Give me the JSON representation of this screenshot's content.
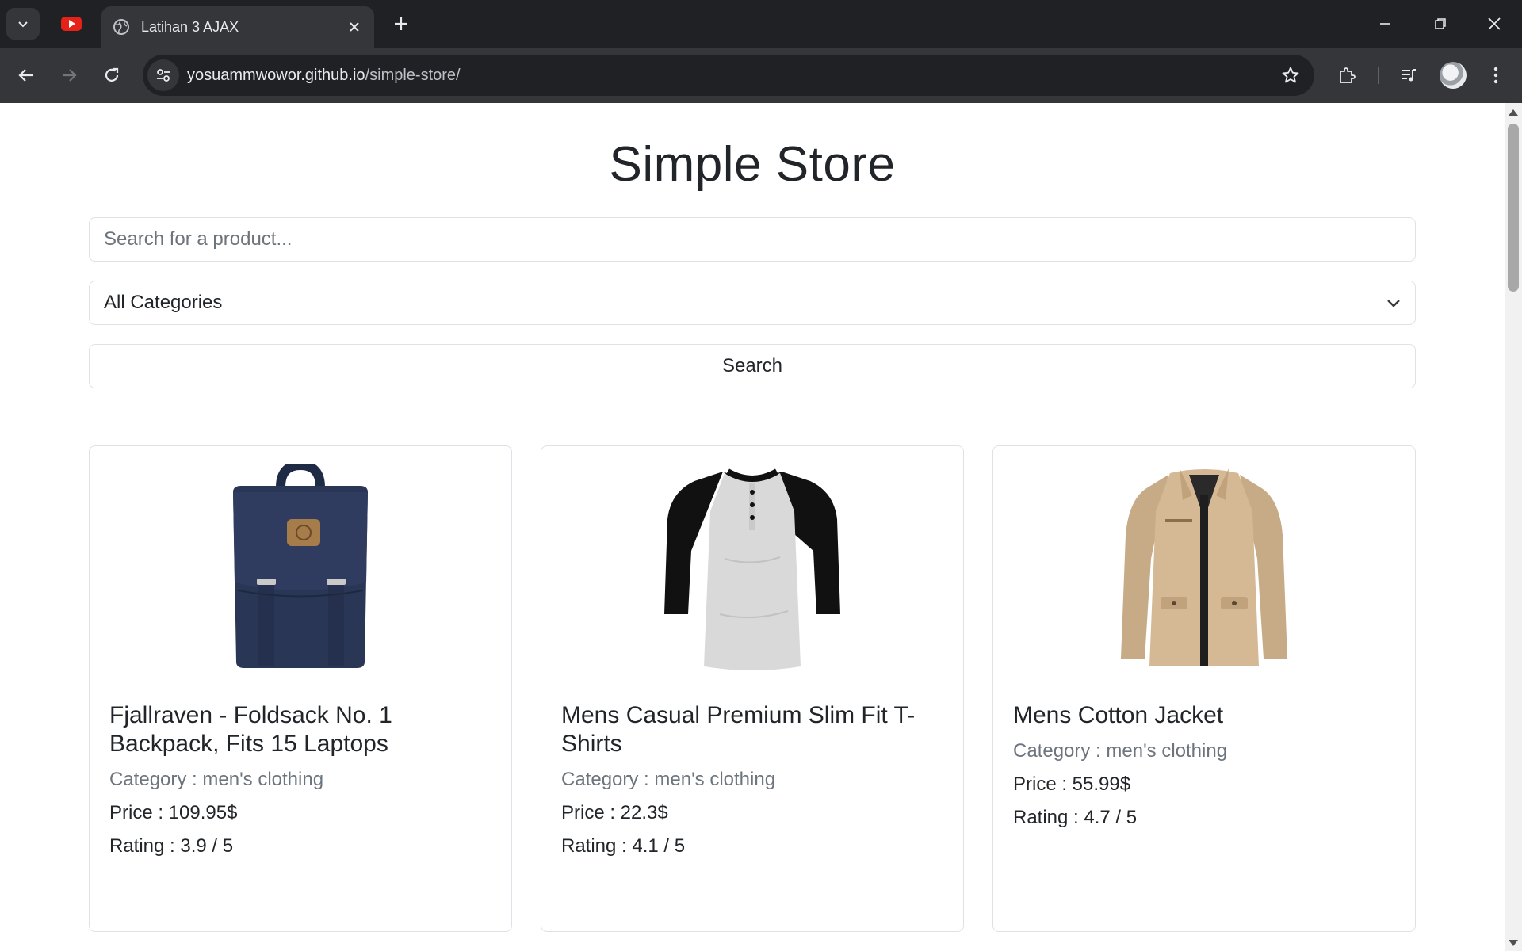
{
  "browser": {
    "tab_title": "Latihan 3 AJAX",
    "url_domain": "yosuammwowor.github.io",
    "url_path": "/simple-store/"
  },
  "page": {
    "title": "Simple Store",
    "search_placeholder": "Search for a product...",
    "category_selected": "All Categories",
    "search_button": "Search"
  },
  "products": [
    {
      "title": "Fjallraven - Foldsack No. 1 Backpack, Fits 15 Laptops",
      "category": "Category : men's clothing",
      "price": "Price : 109.95$",
      "rating": "Rating : 3.9 / 5",
      "image_icon": "backpack-image"
    },
    {
      "title": "Mens Casual Premium Slim Fit T-Shirts",
      "category": "Category : men's clothing",
      "price": "Price : 22.3$",
      "rating": "Rating : 4.1 / 5",
      "image_icon": "tshirt-image"
    },
    {
      "title": "Mens Cotton Jacket",
      "category": "Category : men's clothing",
      "price": "Price : 55.99$",
      "rating": "Rating : 4.7 / 5",
      "image_icon": "jacket-image"
    }
  ]
}
